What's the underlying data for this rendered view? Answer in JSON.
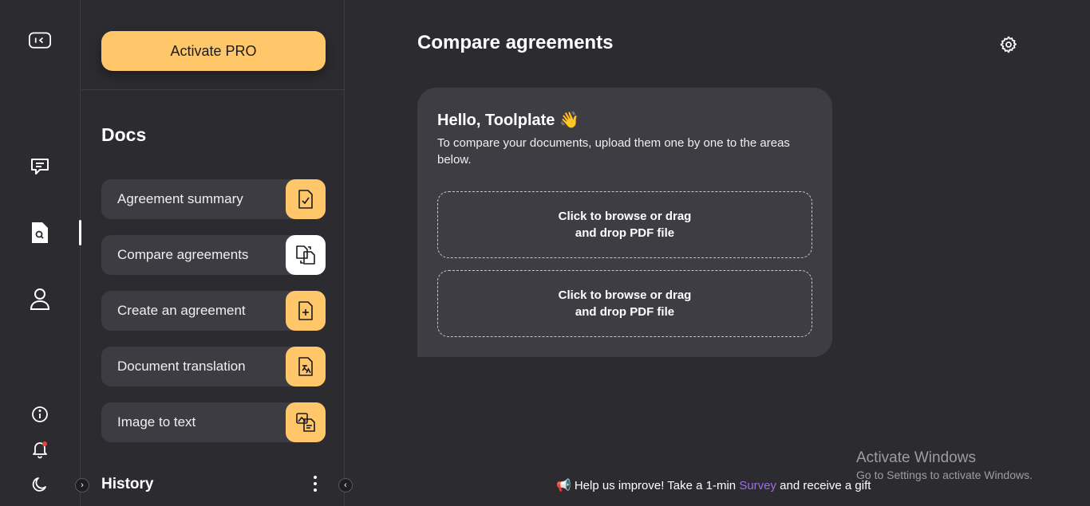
{
  "rail": {
    "icons": [
      "collapse-sidebar-icon",
      "chat-icon",
      "document-search-icon",
      "user-icon",
      "info-icon",
      "bell-icon",
      "moon-icon"
    ]
  },
  "sidebar": {
    "activate_label": "Activate PRO",
    "docs_title": "Docs",
    "items": [
      {
        "label": "Agreement summary",
        "icon": "document-check-icon"
      },
      {
        "label": "Compare agreements",
        "icon": "compare-documents-icon"
      },
      {
        "label": "Create an agreement",
        "icon": "document-add-icon"
      },
      {
        "label": "Document translation",
        "icon": "document-translate-icon"
      },
      {
        "label": "Image to text",
        "icon": "image-to-text-icon"
      }
    ],
    "history_label": "History"
  },
  "main": {
    "title": "Compare agreements",
    "greeting": "Hello, Toolplate 👋",
    "intro": "To compare your documents, upload them one by one to the areas below.",
    "dropzones": [
      {
        "line1": "Click to browse or drag",
        "line2": "and drop PDF file"
      },
      {
        "line1": "Click to browse or drag",
        "line2": "and drop PDF file"
      }
    ]
  },
  "survey": {
    "prefix": "📢 Help us improve! Take a 1-min ",
    "link": "Survey",
    "suffix": " and receive a gift"
  },
  "watermark": {
    "title": "Activate Windows",
    "subtitle": "Go to Settings to activate Windows."
  },
  "colors": {
    "accent": "#ffc76a",
    "background": "#2c2c30",
    "card": "#3d3d43",
    "link": "#9a6fe0"
  }
}
